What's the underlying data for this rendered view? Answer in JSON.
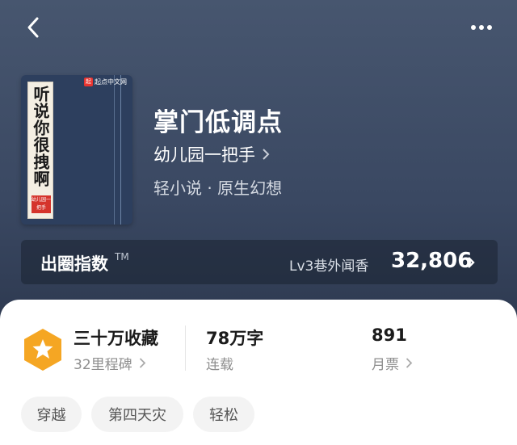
{
  "book": {
    "title": "掌门低调点",
    "author": "幼儿园一把手",
    "genre": "轻小说 · 原生幻想",
    "cover": {
      "publisher": "起点中文网",
      "title_text": "听说你很拽啊",
      "stamp_text": "幼儿园一把手"
    }
  },
  "index": {
    "label": "出圈指数",
    "trademark": "TM",
    "level": "Lv3巷外闻香",
    "value": "32,806"
  },
  "stats": {
    "collection_title": "三十万收藏",
    "collection_sub": "32里程碑",
    "words_num": "78",
    "words_unit": "万字",
    "words_sub": "连载",
    "tickets_num": "891",
    "tickets_sub": "月票"
  },
  "tags": [
    "穿越",
    "第四天灾",
    "轻松"
  ],
  "colors": {
    "badge": "#f5a623",
    "background": "#3a4862"
  },
  "icons": {
    "back": "chevron-left-icon",
    "more": "more-dots-icon",
    "badge": "star-hexagon-icon"
  }
}
